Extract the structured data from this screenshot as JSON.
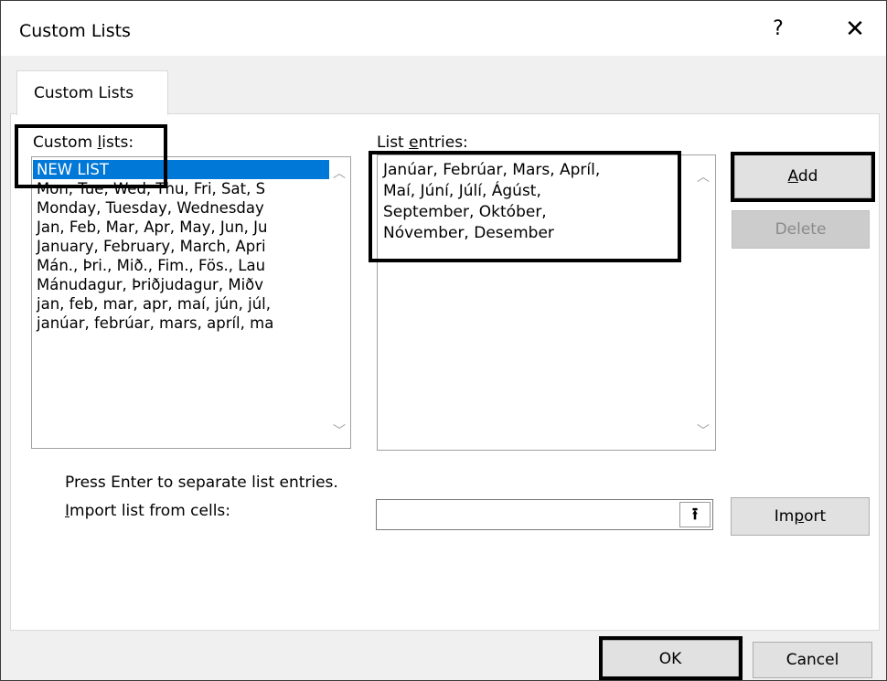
{
  "dialog": {
    "title": "Custom Lists",
    "help_label": "?",
    "close_label": "✕"
  },
  "tab": {
    "label": "Custom Lists"
  },
  "custom_lists": {
    "label_prefix": "Custom ",
    "label_accel": "l",
    "label_suffix": "ists:",
    "items": [
      "NEW LIST",
      "Mon, Tue, Wed, Thu, Fri, Sat, S",
      "Monday, Tuesday, Wednesday",
      "Jan, Feb, Mar, Apr, May, Jun, Ju",
      "January, February, March, Apri",
      "Mán., Þri., Mið., Fim., Fös., Lau",
      "Mánudagur, Þriðjudagur, Miðv",
      "jan, feb, mar, apr, maí, jún, júl,",
      "janúar, febrúar, mars, apríl, ma"
    ],
    "selected_index": 0
  },
  "list_entries": {
    "label_prefix": "List ",
    "label_accel": "e",
    "label_suffix": "ntries:",
    "text": "Janúar, Febrúar, Mars, Apríl,\nMaí, Júní, Júlí, Ágúst,\nSeptember, Október,\nNóvember, Desember"
  },
  "buttons": {
    "add_accel": "A",
    "add_rest": "dd",
    "delete": "Delete",
    "import_prefix": "Im",
    "import_accel": "p",
    "import_suffix": "ort",
    "ok": "OK",
    "cancel": "Cancel",
    "upload_icon": "⭱"
  },
  "hint": "Press Enter to separate list entries.",
  "import_label": {
    "accel": "I",
    "rest": "mport list from cells:"
  },
  "import_field": {
    "value": ""
  }
}
